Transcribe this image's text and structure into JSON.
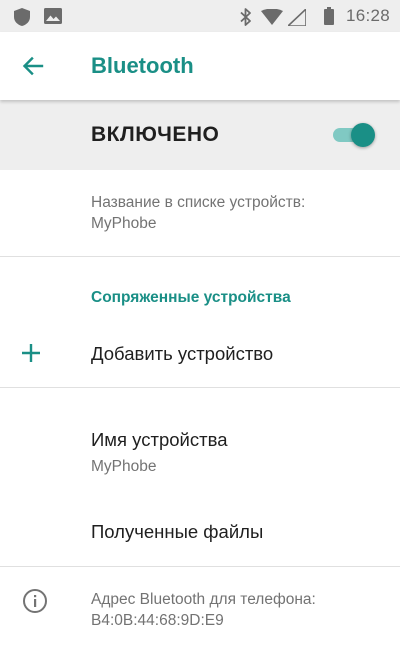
{
  "status_bar": {
    "time": "16:28",
    "left_icons": [
      "shield-icon",
      "image-icon"
    ],
    "right_icons": [
      "bluetooth-icon",
      "wifi-icon",
      "signal-icon",
      "battery-icon"
    ]
  },
  "app_bar": {
    "title": "Bluetooth",
    "back_icon": "arrow-back-icon"
  },
  "master_switch": {
    "label": "ВКЛЮЧЕНО",
    "state": "on"
  },
  "device_name_info": {
    "label": "Название в списке устройств:",
    "value": "MyPhobe"
  },
  "paired_devices": {
    "header": "Сопряженные устройства",
    "add_label": "Добавить устройство",
    "add_icon": "plus-icon"
  },
  "device_name_setting": {
    "title": "Имя устройства",
    "value": "MyPhobe"
  },
  "received_files": {
    "title": "Полученные файлы"
  },
  "address_info": {
    "label": "Адрес Bluetooth для телефона:",
    "value": "B4:0B:44:68:9D:E9",
    "icon": "info-icon"
  },
  "colors": {
    "accent": "#1a8f86",
    "switch_track": "#80c9c3",
    "status_bar_bg": "#eeeeee",
    "master_row_bg": "#eeeeee",
    "secondary_text": "#737373"
  }
}
